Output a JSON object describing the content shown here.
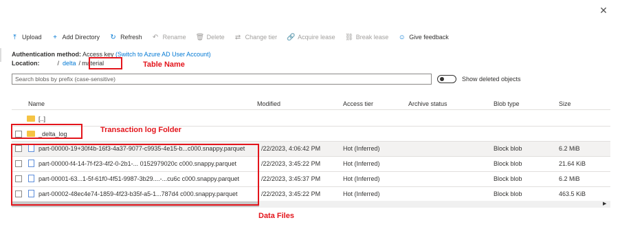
{
  "toolbar": {
    "upload": "Upload",
    "add_directory": "Add Directory",
    "refresh": "Refresh",
    "rename": "Rename",
    "delete": "Delete",
    "change_tier": "Change tier",
    "acquire_lease": "Acquire lease",
    "break_lease": "Break lease",
    "give_feedback": "Give feedback"
  },
  "auth": {
    "label": "Authentication method:",
    "value": "Access key",
    "switch_link": "(Switch to Azure AD User Account)"
  },
  "location": {
    "label": "Location:",
    "sep1": "/",
    "delta": "delta",
    "sep2": "/",
    "current": "material"
  },
  "search": {
    "placeholder": "Search blobs by prefix (case-sensitive)"
  },
  "toggle_label": "Show deleted objects",
  "columns": {
    "name": "Name",
    "modified": "Modified",
    "access_tier": "Access tier",
    "archive_status": "Archive status",
    "blob_type": "Blob type",
    "size": "Size"
  },
  "folders": [
    {
      "name": "[..]"
    },
    {
      "name": "_delta_log"
    }
  ],
  "files": [
    {
      "name": "part-00000-19+30f4b-16f3-4a37-9077-c9935-4e15-b...c000.snappy.parquet",
      "modified": "/22/2023, 4:06:42 PM",
      "tier": "Hot (Inferred)",
      "type": "Block blob",
      "size": "6.2 MiB"
    },
    {
      "name": "part-00000-f4-14-7f-f23-4f2-0-2b1-... 0152979020c c000.snappy.parquet",
      "modified": "/22/2023, 3:45:22 PM",
      "tier": "Hot (Inferred)",
      "type": "Block blob",
      "size": "21.64 KiB"
    },
    {
      "name": "part-00001-63...1-5f-61f0-4f51-9987-3b29....-...cu6c c000.snappy.parquet",
      "modified": "/22/2023, 3:45:37 PM",
      "tier": "Hot (Inferred)",
      "type": "Block blob",
      "size": "6.2 MiB"
    },
    {
      "name": "part-00002-48ec4e74-1859-4f23-b35f-a5-1...787d4 c000.snappy.parquet",
      "modified": "/22/2023, 3:45:22 PM",
      "tier": "Hot (Inferred)",
      "type": "Block blob",
      "size": "463.5 KiB"
    }
  ],
  "annotations": {
    "table_name": "Table Name",
    "transaction_log": "Transaction log Folder",
    "data_files": "Data Files"
  },
  "colors": {
    "accent": "#0078d4",
    "annotation": "#e3141b",
    "folder": "#f5c343"
  }
}
